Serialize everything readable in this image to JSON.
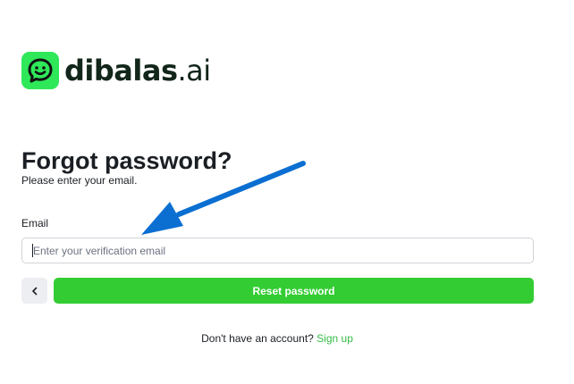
{
  "brand": {
    "name_main": "dibalas",
    "name_suffix": ".ai",
    "logo_icon": "smiley-chat-icon",
    "accent_color": "#2ee85a"
  },
  "form": {
    "title": "Forgot password?",
    "subtitle": "Please enter your email.",
    "email_label": "Email",
    "email_placeholder": "Enter your verification email",
    "email_value": "",
    "back_icon": "chevron-left-icon",
    "reset_label": "Reset password",
    "reset_color": "#33cc33"
  },
  "footer": {
    "prompt": "Don't have an account?",
    "signup_label": "Sign up"
  },
  "annotation": {
    "arrow_icon": "pointer-arrow-icon",
    "color": "#0a6fd1"
  }
}
